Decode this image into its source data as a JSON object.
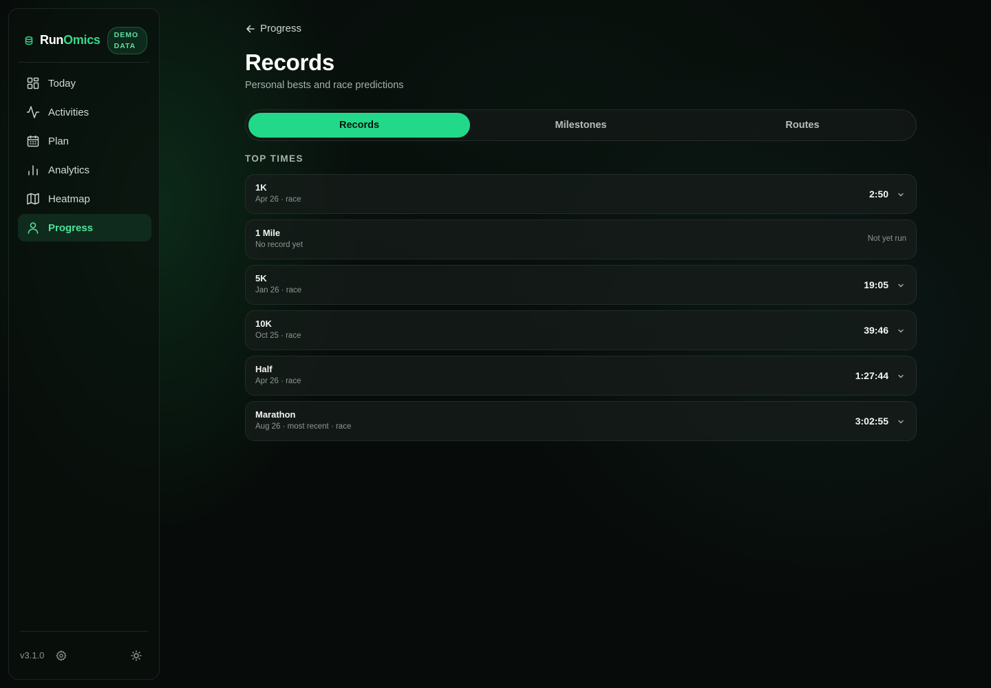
{
  "brand": {
    "name_a": "Run",
    "name_b": "Omics",
    "badge_line1": "DEMO",
    "badge_line2": "DATA"
  },
  "sidebar": {
    "items": [
      {
        "label": "Today",
        "icon": "grid-icon"
      },
      {
        "label": "Activities",
        "icon": "activity-icon"
      },
      {
        "label": "Plan",
        "icon": "calendar-icon"
      },
      {
        "label": "Analytics",
        "icon": "bar-chart-icon"
      },
      {
        "label": "Heatmap",
        "icon": "map-icon"
      },
      {
        "label": "Progress",
        "icon": "user-icon",
        "active": true
      }
    ],
    "version": "v3.1.0"
  },
  "header": {
    "back_label": "Progress",
    "title": "Records",
    "subtitle": "Personal bests and race predictions"
  },
  "tabs": [
    {
      "label": "Records",
      "active": true
    },
    {
      "label": "Milestones"
    },
    {
      "label": "Routes"
    }
  ],
  "section": {
    "label": "TOP TIMES"
  },
  "records": [
    {
      "name": "1K",
      "meta": "Apr 26 · race",
      "time": "2:50"
    },
    {
      "name": "1 Mile",
      "meta": "No record yet",
      "status": "Not yet run"
    },
    {
      "name": "5K",
      "meta": "Jan 26 · race",
      "time": "19:05"
    },
    {
      "name": "10K",
      "meta": "Oct 25 · race",
      "time": "39:46"
    },
    {
      "name": "Half",
      "meta": "Apr 26 · race",
      "time": "1:27:44"
    },
    {
      "name": "Marathon",
      "meta": "Aug 26 · most recent · race",
      "time": "3:02:55"
    }
  ],
  "colors": {
    "accent": "#22d98a",
    "background": "#070b09",
    "card": "#161c1a"
  }
}
